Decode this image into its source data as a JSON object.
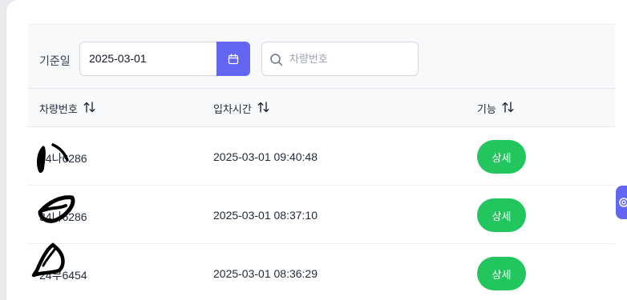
{
  "filter": {
    "label": "기준일",
    "date_value": "2025-03-01",
    "search_placeholder": "차량번호"
  },
  "table": {
    "columns": [
      "차량번호",
      "입차시간",
      "기능"
    ],
    "rows": [
      {
        "plate": "34나6286",
        "entry_time": "2025-03-01 09:40:48",
        "action": "상세"
      },
      {
        "plate": "34나6286",
        "entry_time": "2025-03-01 08:37:10",
        "action": "상세"
      },
      {
        "plate": "24부6454",
        "entry_time": "2025-03-01 08:36:29",
        "action": "상세"
      }
    ]
  },
  "colors": {
    "accent": "#6366f1",
    "detail_button": "#22c55e"
  }
}
